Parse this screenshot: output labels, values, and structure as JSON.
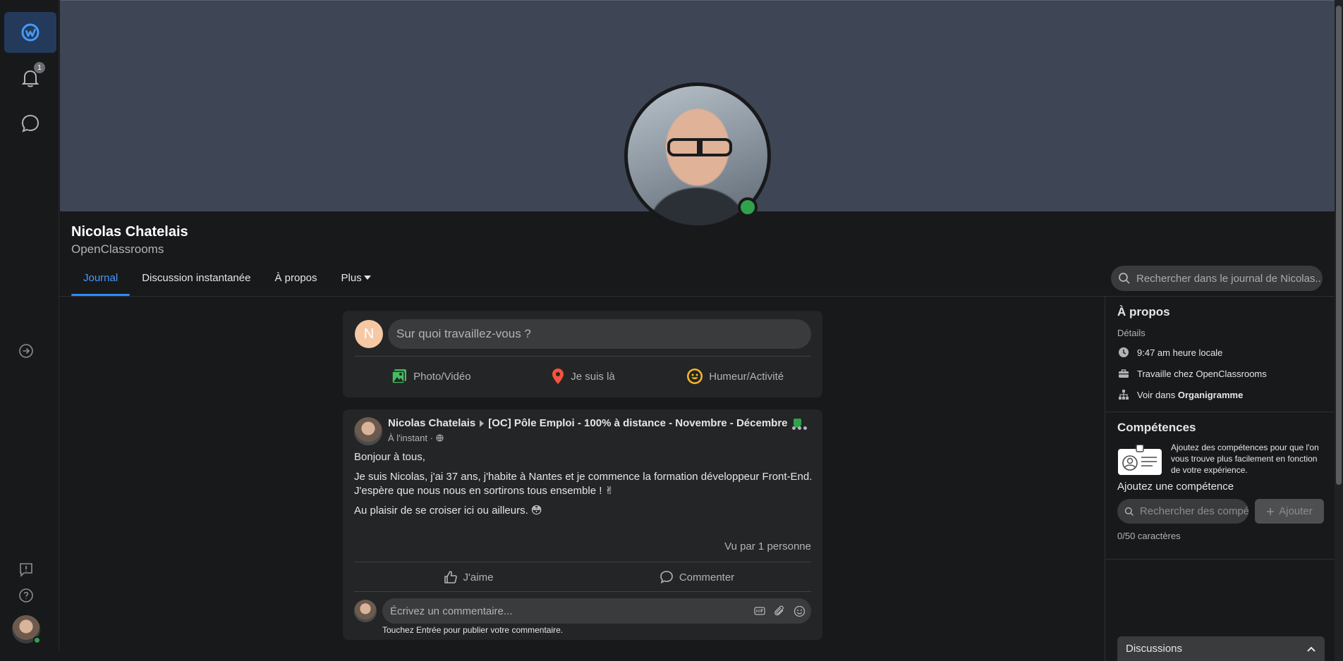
{
  "rail": {
    "notifications_count": "1"
  },
  "profile": {
    "name": "Nicolas Chatelais",
    "company": "OpenClassrooms"
  },
  "tabs": [
    {
      "label": "Journal"
    },
    {
      "label": "Discussion instantanée"
    },
    {
      "label": "À propos"
    },
    {
      "label": "Plus"
    }
  ],
  "search": {
    "placeholder": "Rechercher dans le journal de Nicolas.."
  },
  "composer": {
    "avatar_letter": "N",
    "placeholder": "Sur quoi travaillez-vous ?",
    "actions": [
      {
        "label": "Photo/Vidéo",
        "icon": "photo-icon"
      },
      {
        "label": "Je suis là",
        "icon": "location-pin-icon"
      },
      {
        "label": "Humeur/Activité",
        "icon": "smiley-icon"
      }
    ]
  },
  "post": {
    "author": "Nicolas Chatelais",
    "group": "[OC] Pôle Emploi - 100% à distance - Novembre - Décembre",
    "time": "À l'instant · ",
    "paragraph1": "Bonjour à tous,",
    "paragraph2a": "Je suis Nicolas, j'ai 37 ans, j'habite à Nantes et je commence la formation développeur Front-End.",
    "paragraph2b": "J'espère que nous nous en sortirons tous ensemble ! ✌",
    "paragraph3": "Au plaisir de se croiser ici ou ailleurs. 😳",
    "views": "Vu par 1 personne",
    "like_label": "J'aime",
    "comment_label": "Commenter",
    "comment_placeholder": "Écrivez un commentaire...",
    "comment_hint": "Touchez Entrée pour publier votre commentaire."
  },
  "about": {
    "title": "À propos",
    "details_label": "Détails",
    "local_time": "9:47 am heure locale",
    "works_at": "Travaille chez OpenClassrooms",
    "org_prefix": "Voir dans ",
    "org_link": "Organigramme"
  },
  "skills": {
    "title": "Compétences",
    "description": "Ajoutez des compétences pour que l'on vous trouve plus facilement en fonction de votre expérience.",
    "add_label": "Ajoutez une compétence",
    "search_placeholder": "Rechercher des compétences",
    "add_button": "Ajouter",
    "char_count": "0/50 caractères"
  },
  "discussions": {
    "label": "Discussions"
  },
  "colors": {
    "accent": "#2d88ff",
    "online": "#31a24c",
    "cover": "#3e4555"
  }
}
